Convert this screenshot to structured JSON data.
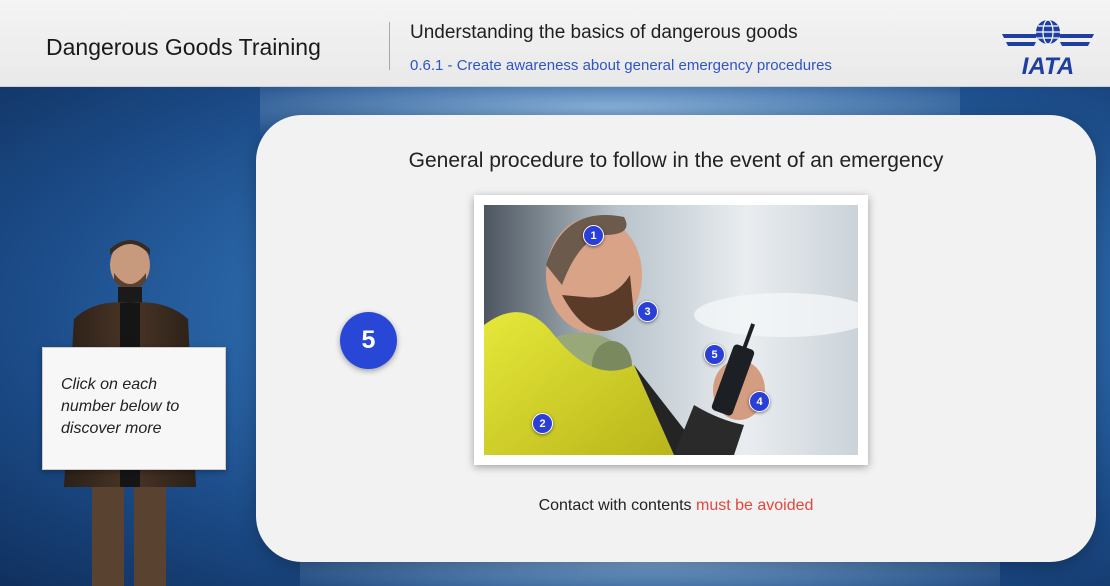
{
  "header": {
    "course_title": "Dangerous Goods Training",
    "module_title": "Understanding the basics of dangerous goods",
    "module_subtitle": "0.6.1 - Create awareness about general emergency procedures",
    "logo_text": "IATA"
  },
  "card": {
    "title": "General procedure to follow in the event of an emergency",
    "current_step": "5",
    "hotspots": [
      "1",
      "2",
      "3",
      "4",
      "5"
    ],
    "caption_prefix": "Contact with contents ",
    "caption_highlight": "must be avoided"
  },
  "presenter": {
    "sign_text": "Click on each number below to discover more"
  },
  "colors": {
    "accent": "#2847d6",
    "warning": "#e3463d",
    "subtitle": "#2f55c4"
  }
}
